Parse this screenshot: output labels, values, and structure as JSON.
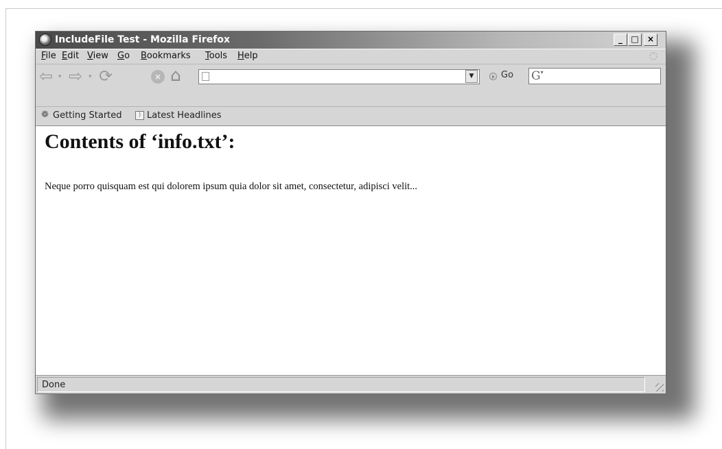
{
  "window": {
    "title": "IncludeFile Test - Mozilla Firefox",
    "minimize": "_",
    "maximize": "□",
    "close": "×"
  },
  "menu": {
    "items": [
      {
        "key": "F",
        "rest": "ile"
      },
      {
        "key": "E",
        "rest": "dit"
      },
      {
        "key": "V",
        "rest": "iew"
      },
      {
        "key": "G",
        "rest": "o"
      },
      {
        "key": "B",
        "rest": "ookmarks"
      },
      {
        "key": "T",
        "rest": "ools"
      },
      {
        "key": "H",
        "rest": "elp"
      }
    ]
  },
  "navigation": {
    "url_value": "",
    "go_label": "Go",
    "search_value": "",
    "icons": [
      "back-icon",
      "forward-icon",
      "reload-icon",
      "stop-icon",
      "home-icon",
      "page-icon",
      "go-icon",
      "search-engine-icon"
    ]
  },
  "bookmarks": {
    "getting_started": "Getting Started",
    "latest_headlines": "Latest Headlines"
  },
  "page": {
    "heading": "Contents of ‘info.txt’:",
    "body": "Neque porro quisquam est qui dolorem ipsum quia dolor sit amet, consectetur, adipisci velit..."
  },
  "status": {
    "text": "Done"
  },
  "colors": {
    "chrome": "#d6d6d6",
    "title_gradient_start": "#4a4a4a",
    "title_gradient_end": "#d4d4d4",
    "content_background": "#ffffff"
  }
}
